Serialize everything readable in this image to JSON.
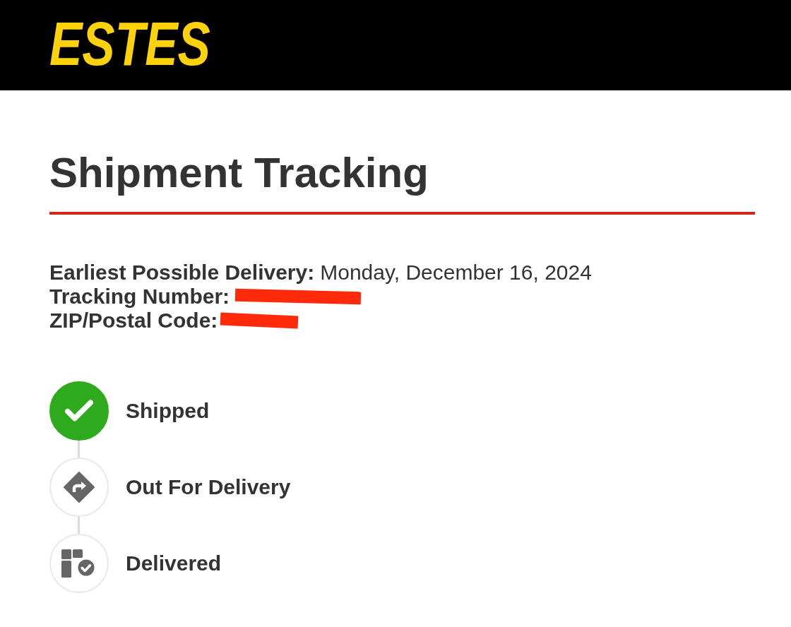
{
  "header": {
    "logo": "ESTES"
  },
  "page": {
    "title": "Shipment Tracking"
  },
  "details": [
    {
      "label": "Earliest Possible Delivery:",
      "value": "Monday, December 16, 2024"
    },
    {
      "label": "Tracking Number:",
      "redacted": true
    },
    {
      "label": "ZIP/Postal Code:",
      "redacted": true
    }
  ],
  "steps": [
    {
      "kind": "shipped",
      "label": "Shipped",
      "completed": true
    },
    {
      "kind": "out_for_delivery",
      "label": "Out For Delivery",
      "completed": false
    },
    {
      "kind": "delivered",
      "label": "Delivered",
      "completed": false
    }
  ]
}
